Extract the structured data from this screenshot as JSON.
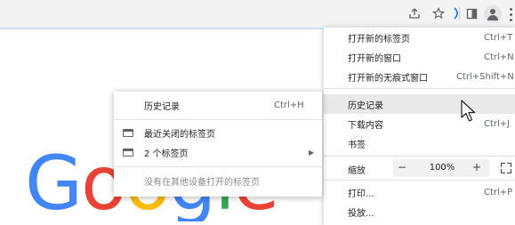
{
  "toolbar": {
    "icons": [
      "share-icon",
      "star-icon",
      "tab-search-icon",
      "profile-icon",
      "more-icon"
    ]
  },
  "logo": {
    "text": "Google",
    "partial": "Gooyle",
    "colors": [
      "#4285f4",
      "#ea4335",
      "#fbbc05",
      "#4285f4",
      "#34a853",
      "#ea4335"
    ]
  },
  "main_menu": {
    "items": [
      {
        "label": "打开新的标签页",
        "shortcut": "Ctrl+T"
      },
      {
        "label": "打开新的窗口",
        "shortcut": "Ctrl+N"
      },
      {
        "label": "打开新的无痕式窗口",
        "shortcut": "Ctrl+Shift+N"
      },
      {
        "label": "历史记录",
        "shortcut": ""
      },
      {
        "label": "下载内容",
        "shortcut": "Ctrl+J"
      },
      {
        "label": "书签",
        "shortcut": ""
      }
    ],
    "zoom": {
      "label": "缩放",
      "minus": "−",
      "value": "100%",
      "plus": "+"
    },
    "bottom_items": [
      {
        "label": "打印...",
        "shortcut": "Ctrl+P"
      },
      {
        "label": "投放...",
        "shortcut": ""
      }
    ]
  },
  "history_submenu": {
    "header": {
      "label": "历史记录",
      "shortcut": "Ctrl+H"
    },
    "items": [
      {
        "label": "最近关闭的标签页"
      },
      {
        "label": "2 个标签页",
        "arrow": "▶"
      }
    ],
    "note": "没有在其他设备打开的标签页"
  }
}
